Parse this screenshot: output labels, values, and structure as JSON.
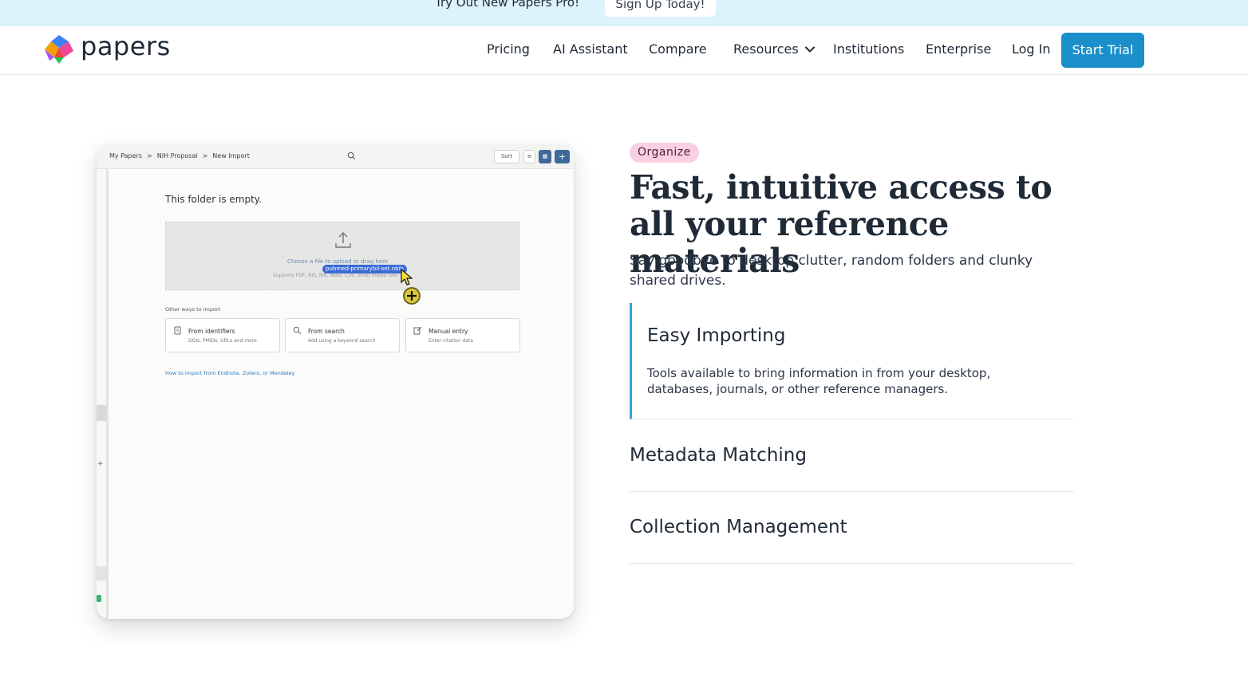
{
  "promo": {
    "text": "Try Out New Papers Pro!",
    "button": "Sign Up Today!"
  },
  "header": {
    "logo_text": "papers",
    "nav": [
      "Pricing",
      "AI Assistant",
      "Compare",
      "Resources",
      "Institutions",
      "Enterprise",
      "Log In"
    ],
    "cta": "Start Trial"
  },
  "app_preview": {
    "breadcrumbs": [
      "My Papers",
      ">",
      "NIH Proposal",
      ">",
      "New Import"
    ],
    "sort_label": "Sort",
    "empty_title": "This folder is empty.",
    "dropzone_text": "Choose a file to upload or drag here",
    "dragged_file": "pubmed-primarybil-set.nbib",
    "dropzone_formats": "Supports PDF, RIS, BIB, NBIB, CSV, other media files",
    "other_ways_label": "Other ways to import",
    "ways": [
      {
        "title": "From identifiers",
        "subtitle": "DOIs, PMIDs, URLs and more",
        "icon": "document-icon"
      },
      {
        "title": "From search",
        "subtitle": "Add using a keyword search",
        "icon": "search-icon"
      },
      {
        "title": "Manual entry",
        "subtitle": "Enter citation data",
        "icon": "edit-icon"
      }
    ],
    "import_link": "How to import from Endnote, Zotero, or Mendeley"
  },
  "content": {
    "tag": "Organize",
    "headline": "Fast, intuitive access to all your reference materials",
    "subheadline": "Say goodbye to desktop clutter, random folders and clunky shared drives.",
    "accordion": [
      {
        "title": "Easy Importing",
        "body": "Tools available to bring information in from your desktop, databases, journals, or other reference managers.",
        "expanded": true
      },
      {
        "title": "Metadata Matching",
        "expanded": false
      },
      {
        "title": "Collection Management",
        "expanded": false
      }
    ]
  },
  "colors": {
    "banner_bg": "#ddf3fb",
    "cta_bg": "#1b8fc9",
    "tag_bg": "#f9cfe3",
    "accent_border": "#3aa4d3"
  }
}
